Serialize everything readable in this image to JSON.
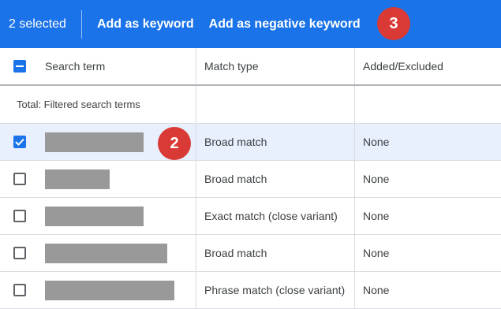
{
  "colors": {
    "action_bar": "#1a73e8",
    "badge": "#d93a35",
    "selected_row": "#e8f0fe"
  },
  "action_bar": {
    "selected_label": "2 selected",
    "add_keyword": "Add as keyword",
    "add_negative": "Add as negative keyword"
  },
  "badges": {
    "step3": "3",
    "step2": "2"
  },
  "table": {
    "headers": {
      "search_term": "Search term",
      "match_type": "Match type",
      "added_excluded": "Added/Excluded"
    },
    "total_label": "Total: Filtered search terms",
    "rows": [
      {
        "checked": true,
        "match_type": "Broad match",
        "status": "None"
      },
      {
        "checked": false,
        "match_type": "Broad match",
        "status": "None"
      },
      {
        "checked": false,
        "match_type": "Exact match (close variant)",
        "status": "None"
      },
      {
        "checked": false,
        "match_type": "Broad match",
        "status": "None"
      },
      {
        "checked": false,
        "match_type": "Phrase match (close variant)",
        "status": "None"
      }
    ]
  }
}
